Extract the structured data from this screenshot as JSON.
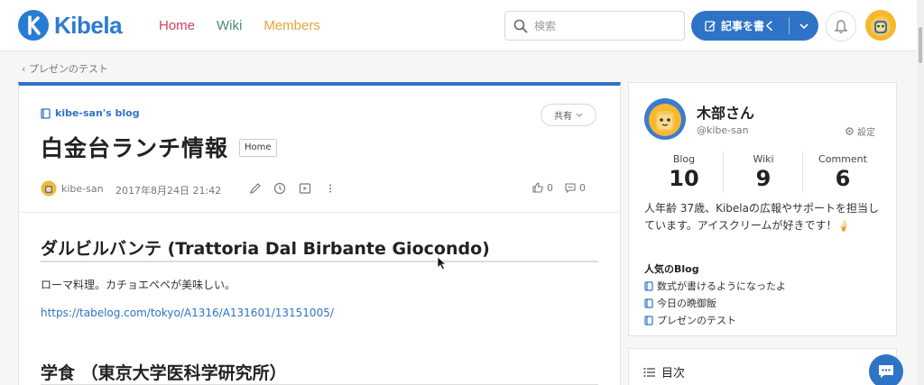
{
  "header": {
    "logo_text": "Kibela",
    "nav": {
      "home": "Home",
      "wiki": "Wiki",
      "members": "Members"
    },
    "search_placeholder": "検索",
    "write_button": "記事を書く"
  },
  "breadcrumb": "‹ プレゼンのテスト",
  "post": {
    "blog_name": "kibe-san's blog",
    "share_label": "共有",
    "title": "白金台ランチ情報",
    "folder_tag": "Home",
    "author": "kibe-san",
    "date": "2017年8月24日 21:42",
    "like_count": "0",
    "comment_count": "0",
    "sections": [
      {
        "heading": "ダルビルバンテ (Trattoria Dal Birbante Giocondo)",
        "text": "ローマ料理。カチョエペペが美味しい。",
        "link": "https://tabelog.com/tokyo/A1316/A131601/13151005/"
      },
      {
        "heading": "学食 （東京大学医科学研究所）"
      }
    ]
  },
  "profile": {
    "name": "木部さん",
    "handle": "@kibe-san",
    "settings_label": "設定",
    "stats": [
      {
        "label": "Blog",
        "value": "10"
      },
      {
        "label": "Wiki",
        "value": "9"
      },
      {
        "label": "Comment",
        "value": "6"
      }
    ],
    "bio": "人年齢 37歳、Kibelaの広報やサポートを担当しています。アイスクリームが好きです！🍦",
    "popular_title": "人気のBlog",
    "popular": [
      "数式が書けるようになったよ",
      "今日の晩御飯",
      "プレゼンのテスト"
    ]
  },
  "toc": {
    "title": "目次"
  },
  "colors": {
    "brand": "#2f73c7",
    "home": "#d43f5a",
    "wiki": "#4a8a7a",
    "members": "#e6a43a"
  }
}
